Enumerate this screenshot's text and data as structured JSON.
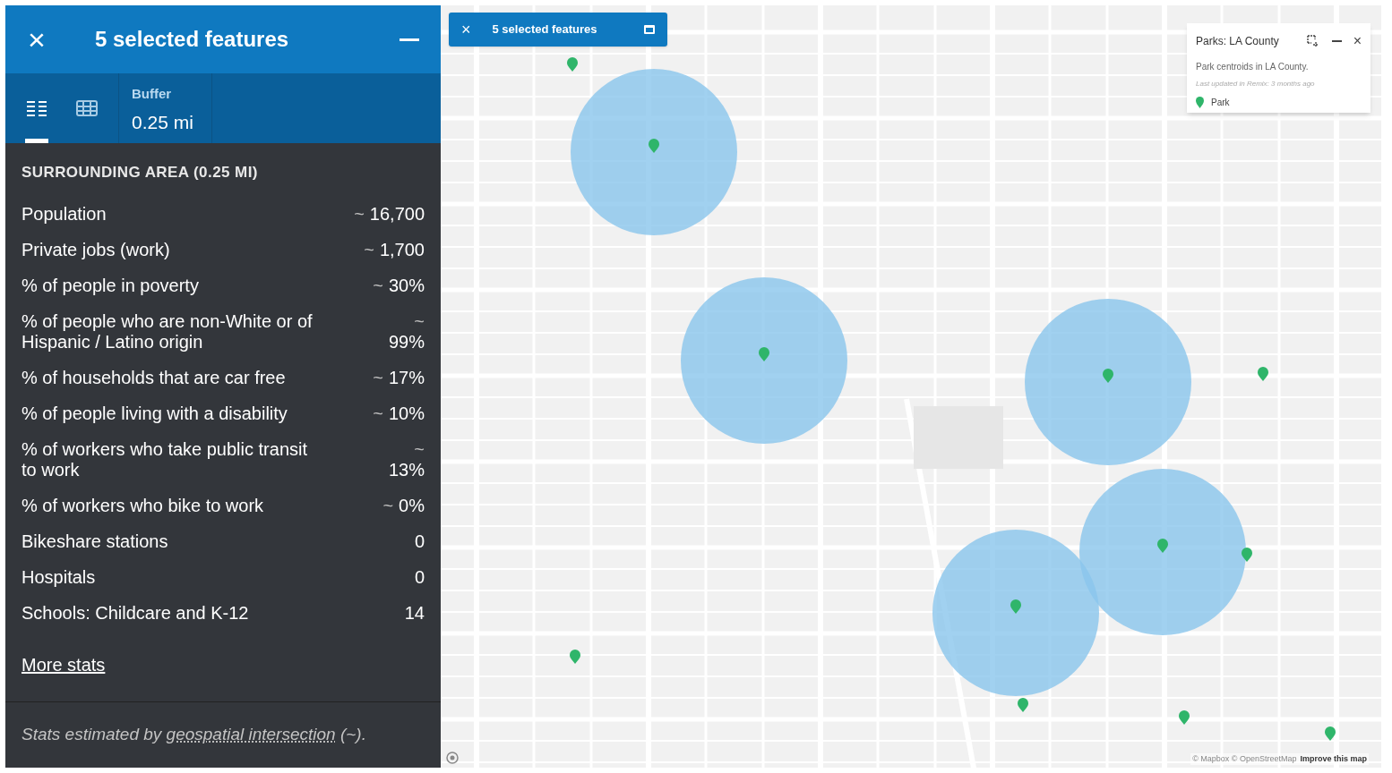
{
  "panel": {
    "title": "5 selected features",
    "close_icon": "×",
    "tabs": [
      {
        "kind": "list",
        "selected": true
      },
      {
        "kind": "table",
        "selected": false
      }
    ],
    "buffer": {
      "label": "Buffer",
      "value": "0.25 mi"
    },
    "section_title": "SURROUNDING AREA (0.25 MI)",
    "stats": [
      {
        "kind": "single",
        "label": "Population",
        "prefix": "~",
        "value": "16,700"
      },
      {
        "kind": "single",
        "label": "Private jobs (work)",
        "prefix": "~",
        "value": "1,700"
      },
      {
        "kind": "single",
        "label": "% of people in poverty",
        "prefix": "~",
        "value": "30%"
      },
      {
        "kind": "wrapped",
        "label": "% of people who are non-White or of Hispanic / Latino origin",
        "prefix": "~",
        "value": "99%"
      },
      {
        "kind": "single",
        "label": "% of households that are car free",
        "prefix": "~",
        "value": "17%"
      },
      {
        "kind": "single",
        "label": "% of people living with a disability",
        "prefix": "~",
        "value": "10%"
      },
      {
        "kind": "wrapped",
        "label": "% of workers who take public transit to work",
        "prefix": "~",
        "value": "13%"
      },
      {
        "kind": "single",
        "label": "% of workers who bike to work",
        "prefix": "~",
        "value": "0%"
      },
      {
        "kind": "single",
        "label": "Bikeshare stations",
        "value": "0"
      },
      {
        "kind": "single",
        "label": "Hospitals",
        "value": "0"
      },
      {
        "kind": "single",
        "label": "Schools: Childcare and K-12",
        "value": "14"
      }
    ],
    "more_link": "More stats",
    "footnote": "Stats estimated by **geospatial intersection** (~)."
  },
  "map": {
    "selection_pill": {
      "title": "5 selected features"
    },
    "legend": {
      "title": "Parks: LA County",
      "description": "Park centroids in LA County.",
      "updated": "Last updated in Remix: 3 months ago",
      "items": [
        {
          "label": "Park",
          "color": "#2fb56a"
        }
      ]
    },
    "attribution": "© Mapbox © OpenStreetMap",
    "improve_link": "Improve this map"
  }
}
